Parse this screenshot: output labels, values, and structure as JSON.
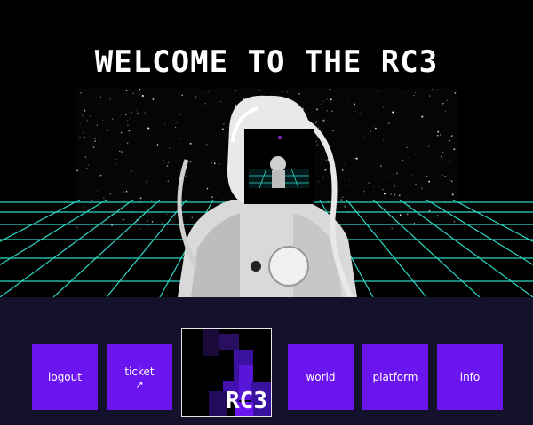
{
  "hero": {
    "title": "WELCOME TO THE RC3"
  },
  "nav": {
    "items": [
      {
        "label": "logout",
        "icon": ""
      },
      {
        "label": "ticket",
        "icon": "external-link-icon"
      },
      {
        "label": "world",
        "icon": ""
      },
      {
        "label": "platform",
        "icon": ""
      },
      {
        "label": "info",
        "icon": ""
      }
    ],
    "logo_text": "RC3"
  },
  "colors": {
    "accent": "#6a14f0",
    "grid": "#2fd6c4",
    "panel": "#14122a"
  }
}
